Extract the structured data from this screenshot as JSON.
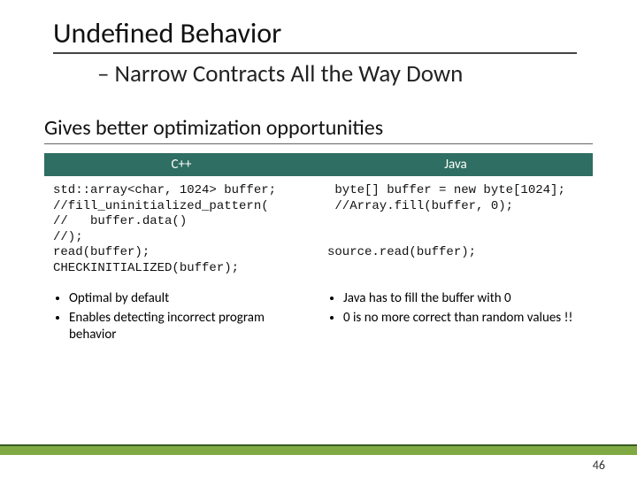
{
  "header": {
    "title": "Undefined Behavior",
    "subtitle": "– Narrow Contracts All the Way Down"
  },
  "section": {
    "heading": "Gives better optimization opportunities",
    "cols": {
      "left": "C++",
      "right": "Java"
    },
    "code": {
      "cpp": "std::array<char, 1024> buffer;\n//fill_uninitialized_pattern(\n//   buffer.data()\n//);\nread(buffer);\nCHECKINITIALIZED(buffer);",
      "java": " byte[] buffer = new byte[1024];\n //Array.fill(buffer, 0);\n\n\nsource.read(buffer);"
    },
    "bullets": {
      "cpp": [
        "Optimal by default",
        "Enables detecting incorrect program behavior"
      ],
      "java": [
        "Java has to fill the buffer with 0",
        "0 is no more correct than random values !!"
      ]
    }
  },
  "footer": {
    "page": "46"
  }
}
